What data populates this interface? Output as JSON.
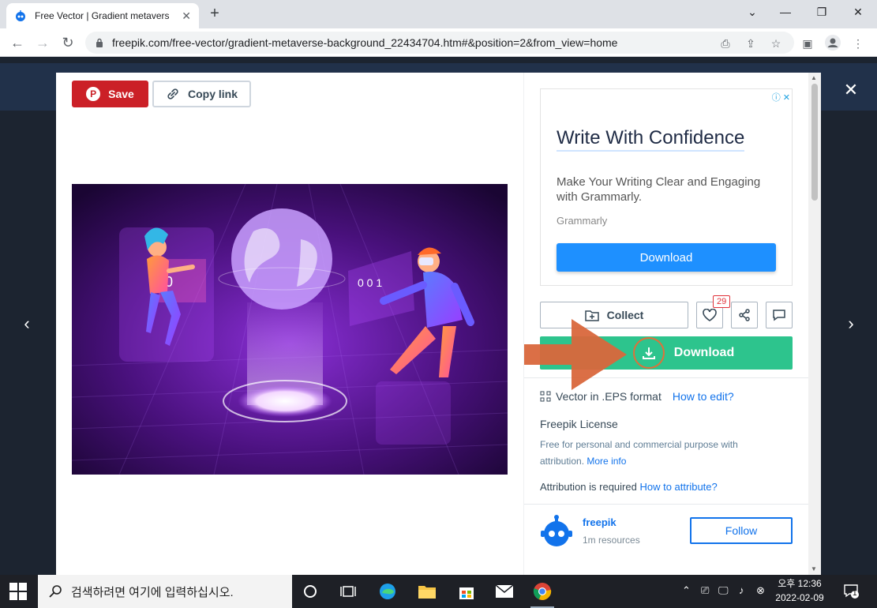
{
  "browser": {
    "tab_title": "Free Vector | Gradient metavers",
    "url": "freepik.com/free-vector/gradient-metaverse-background_22434704.htm#&position=2&from_view=home"
  },
  "modal": {
    "save_label": "Save",
    "copy_link_label": "Copy link"
  },
  "ad": {
    "headline": "Write With Confidence",
    "body": "Make Your Writing Clear and Engaging with Grammarly.",
    "brand": "Grammarly",
    "button": "Download"
  },
  "actions": {
    "collect_label": "Collect",
    "like_count": "29",
    "download_label": "Download"
  },
  "details": {
    "format_text": "Vector in .EPS format",
    "how_to_edit": "How to edit?",
    "license_title": "Freepik License",
    "license_desc": "Free for personal and commercial purpose with attribution.",
    "more_info": "More info",
    "attribution_text": "Attribution is required",
    "how_to_attribute": "How to attribute?"
  },
  "author": {
    "name": "freepik",
    "resources": "1m resources",
    "follow_label": "Follow"
  },
  "taskbar": {
    "search_placeholder": "검색하려면 여기에 입력하십시오.",
    "time": "오후 12:36",
    "date": "2022-02-09",
    "notifications": "1"
  },
  "colors": {
    "save_red": "#cb2027",
    "download_green": "#2dc48d",
    "link_blue": "#1273eb",
    "arrow_orange": "#d9673c"
  }
}
